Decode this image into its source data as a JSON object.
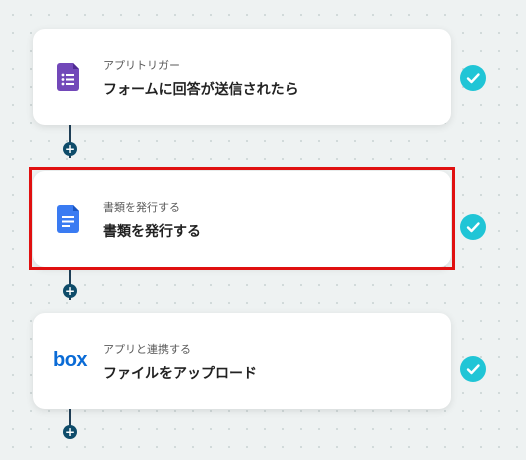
{
  "colors": {
    "connector": "#1f3f57",
    "plus_node": "#0e4c6a",
    "check_badge": "#20c5d6",
    "selection_outline": "#e01010",
    "forms_purple": "#7248b9",
    "docs_blue": "#3a7bf2",
    "box_blue": "#0a6bd6"
  },
  "flow": {
    "steps": [
      {
        "subtitle": "アプリトリガー",
        "title": "フォームに回答が送信されたら",
        "icon": "google-forms-icon",
        "status": "check-icon"
      },
      {
        "subtitle": "書類を発行する",
        "title": "書類を発行する",
        "icon": "google-docs-icon",
        "status": "check-icon",
        "selected": true
      },
      {
        "subtitle": "アプリと連携する",
        "title": "ファイルをアップロード",
        "icon": "box-logo",
        "logo_text": "box",
        "status": "check-icon"
      }
    ],
    "add_step_symbol": "+"
  }
}
